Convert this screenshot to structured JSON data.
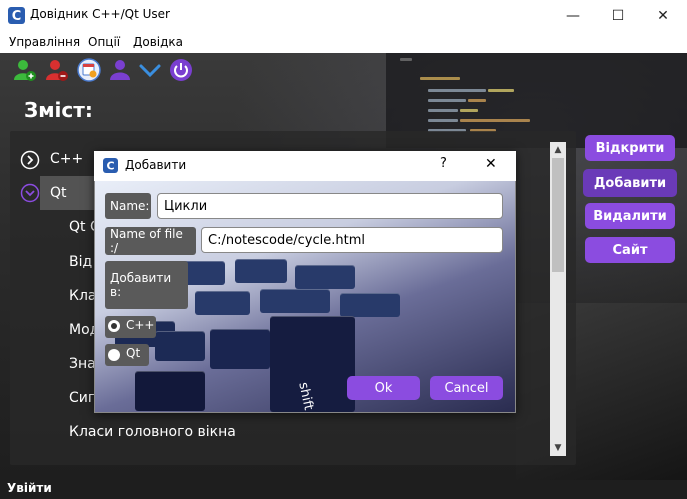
{
  "window": {
    "title": "Довідник C++/Qt User",
    "minimize_glyph": "—",
    "maximize_glyph": "☐",
    "close_glyph": "✕"
  },
  "menu": {
    "items": [
      "Управління",
      "Опції",
      "Довідка"
    ]
  },
  "toolbar": {
    "icons": [
      "user-add-icon",
      "user-remove-icon",
      "calendar-settings-icon",
      "user-manager-icon",
      "chevron-down-icon",
      "power-icon"
    ]
  },
  "contents": {
    "title": "Зміст:",
    "tree": {
      "cpp": "C++",
      "qt": "Qt",
      "children": [
        "Qt C",
        "Від",
        "Кла",
        "Мод",
        "Знач",
        "Сиг",
        "Класи головного вікна"
      ]
    }
  },
  "side_buttons": {
    "open": "Відкрити",
    "add": "Добавити",
    "delete": "Видалити",
    "site": "Сайт"
  },
  "dialog": {
    "title": "Добавити",
    "help_glyph": "?",
    "close_glyph": "✕",
    "name_label": "Name:",
    "name_value": "Цикли",
    "file_label": "Name of file :/",
    "file_value": "C:/notescode/cycle.html",
    "add_to_label": "Добавити в:",
    "radio_cpp": "C++",
    "radio_qt": "Qt",
    "selected": "C++",
    "ok_label": "Ok",
    "cancel_label": "Cancel",
    "key_text": "shift"
  },
  "status": {
    "text": "Увійти"
  },
  "colors": {
    "accent": "#8b4ce0",
    "dark_bg": "#2b2b2b"
  }
}
